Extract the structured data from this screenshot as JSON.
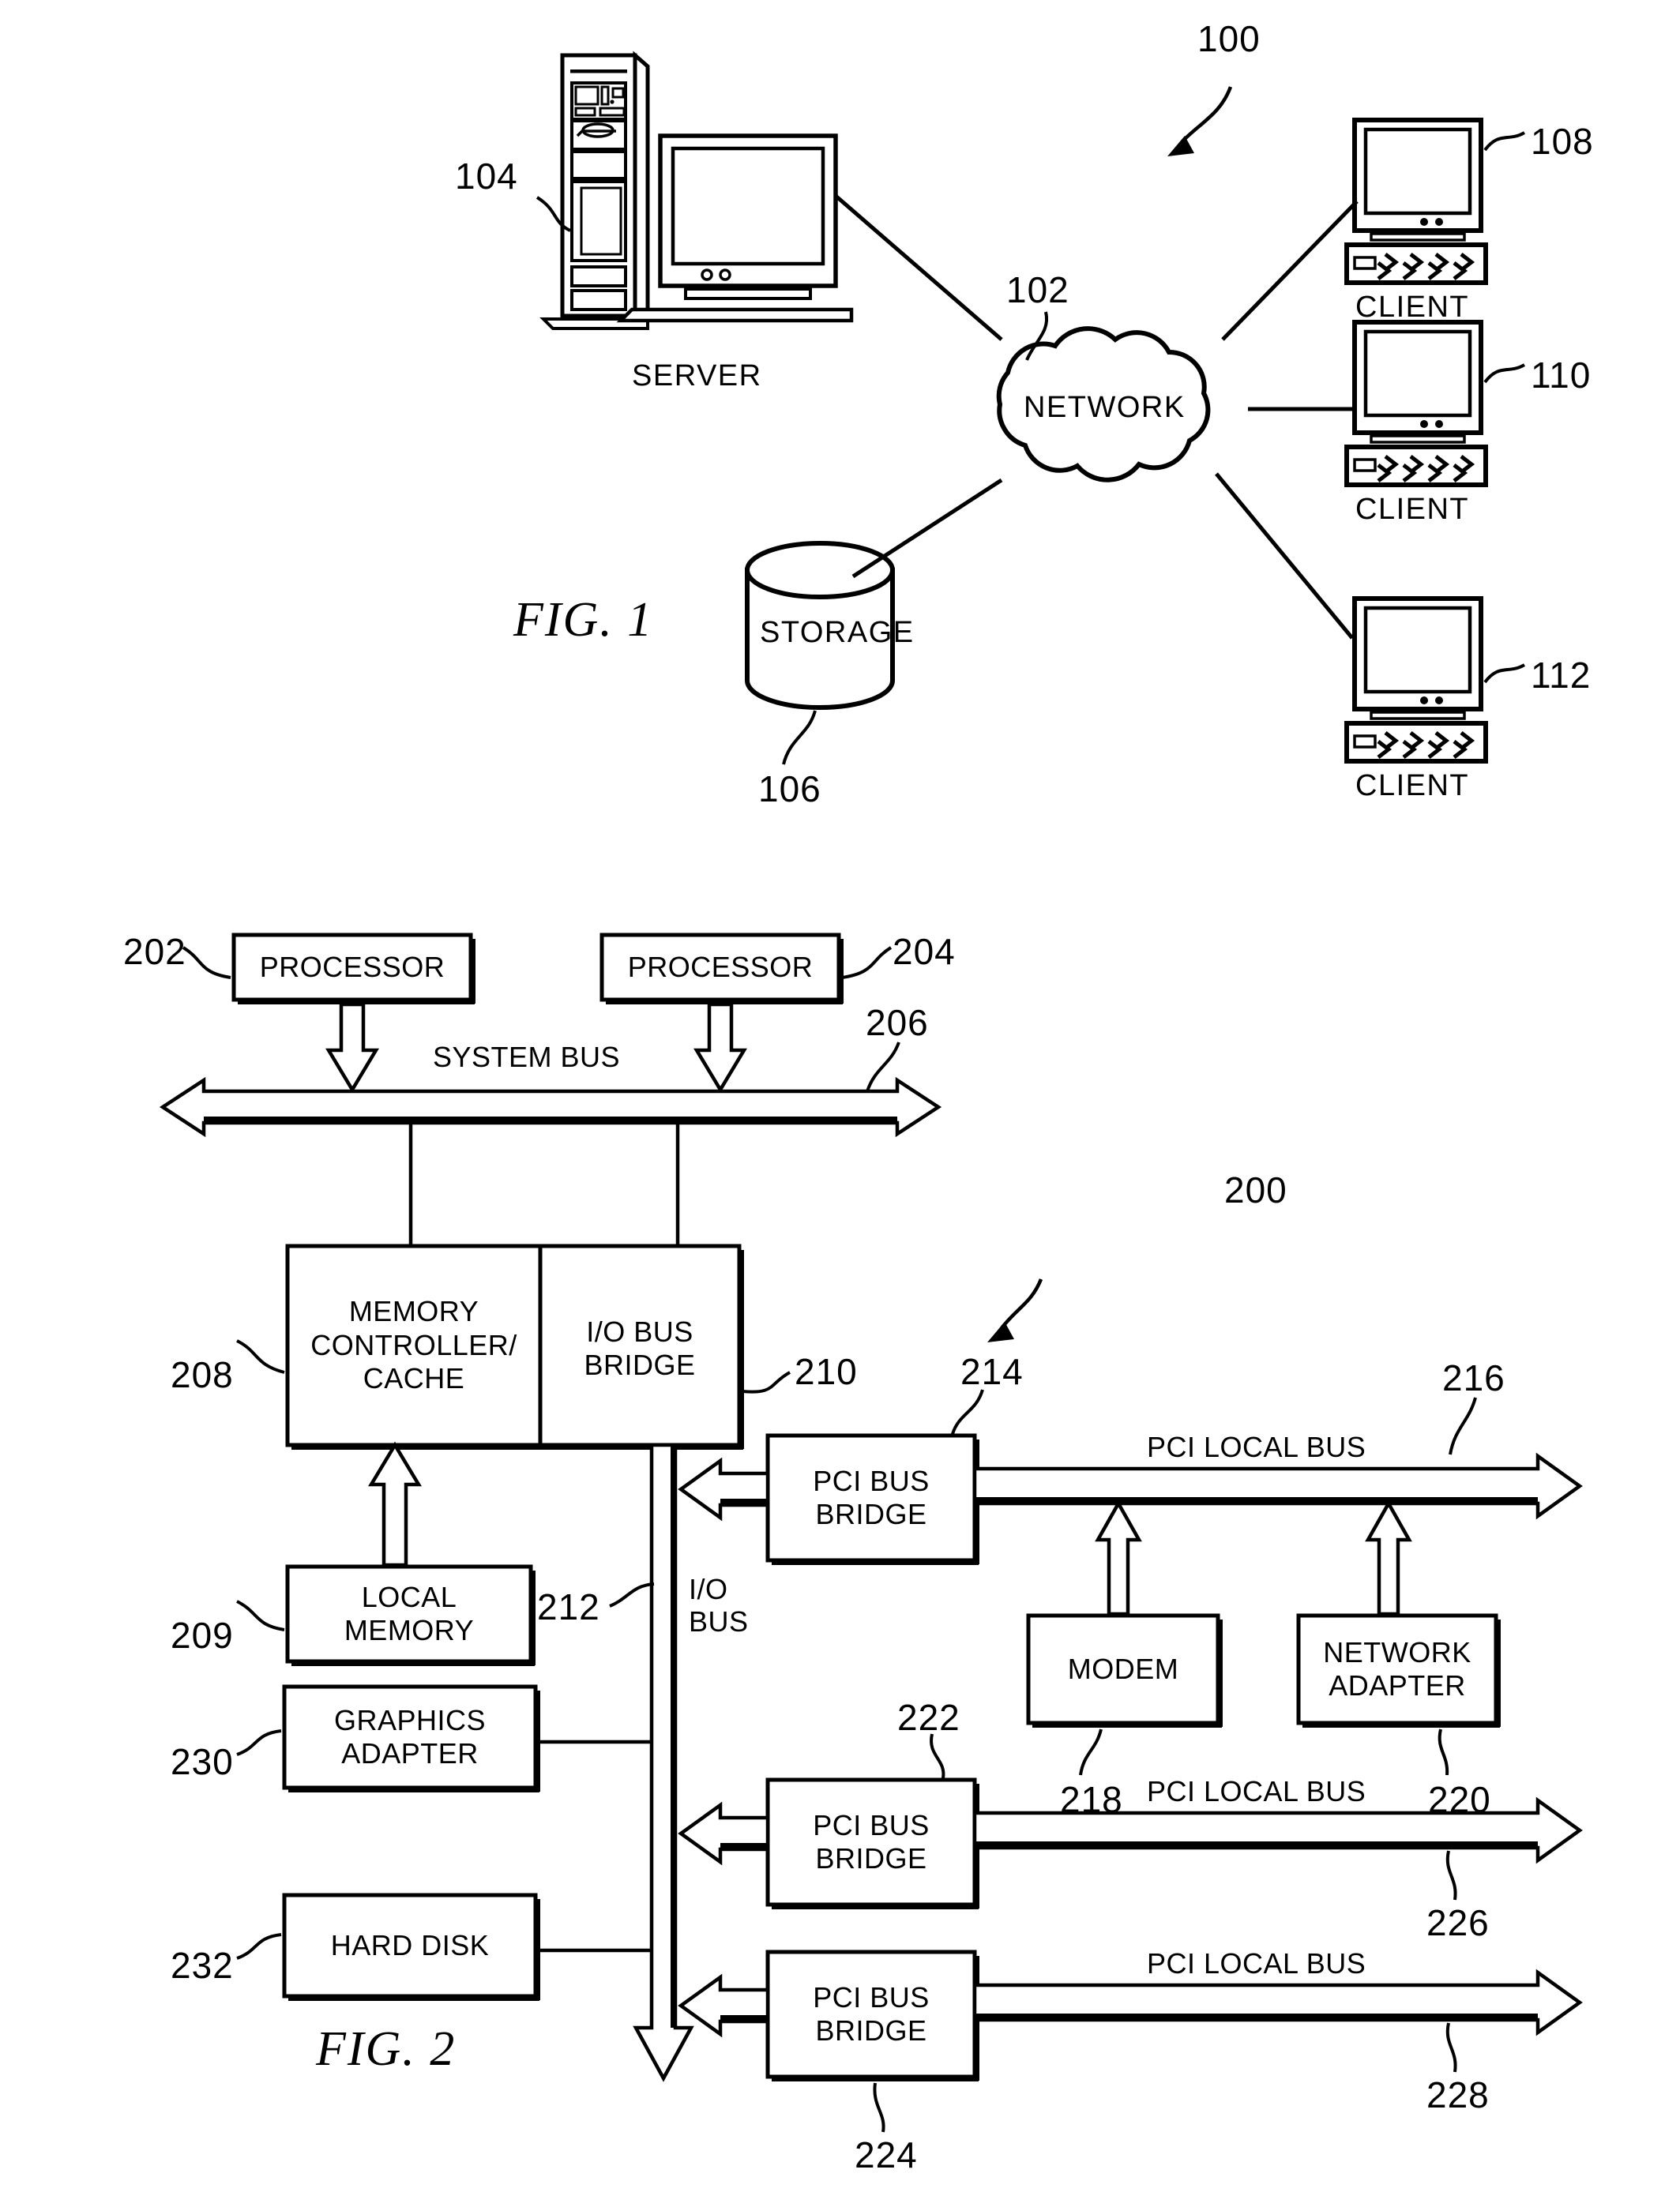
{
  "document": {
    "type": "patent-figure-sheet",
    "figures": [
      "FIG. 1",
      "FIG. 2"
    ]
  },
  "fig1": {
    "label": "FIG. 1",
    "system_ref": "100",
    "nodes": {
      "server": {
        "caption": "SERVER",
        "ref": "104"
      },
      "network": {
        "caption": "NETWORK",
        "ref": "102"
      },
      "storage": {
        "caption": "STORAGE",
        "ref": "106"
      },
      "client1": {
        "caption": "CLIENT",
        "ref": "108"
      },
      "client2": {
        "caption": "CLIENT",
        "ref": "110"
      },
      "client3": {
        "caption": "CLIENT",
        "ref": "112"
      }
    }
  },
  "fig2": {
    "label": "FIG. 2",
    "system_ref": "200",
    "blocks": {
      "processor1": {
        "label": "PROCESSOR",
        "ref": "202"
      },
      "processor2": {
        "label": "PROCESSOR",
        "ref": "204"
      },
      "memory_controller": {
        "line1": "MEMORY",
        "line2": "CONTROLLER/",
        "line3": "CACHE",
        "ref": "208"
      },
      "io_bus_bridge": {
        "line1": "I/O BUS",
        "line2": "BRIDGE",
        "ref": "210"
      },
      "local_memory": {
        "line1": "LOCAL",
        "line2": "MEMORY",
        "ref": "209"
      },
      "pci_bridge_1": {
        "line1": "PCI BUS",
        "line2": "BRIDGE",
        "ref": "214"
      },
      "pci_bridge_2": {
        "line1": "PCI BUS",
        "line2": "BRIDGE",
        "ref": "222"
      },
      "pci_bridge_3": {
        "line1": "PCI BUS",
        "line2": "BRIDGE",
        "ref": "224"
      },
      "modem": {
        "label": "MODEM",
        "ref": "218"
      },
      "network_adapter": {
        "line1": "NETWORK",
        "line2": "ADAPTER",
        "ref": "220"
      },
      "graphics_adapter": {
        "line1": "GRAPHICS",
        "line2": "ADAPTER",
        "ref": "230"
      },
      "hard_disk": {
        "label": "HARD DISK",
        "ref": "232"
      }
    },
    "buses": {
      "system_bus": {
        "label": "SYSTEM BUS",
        "ref": "206"
      },
      "io_bus": {
        "line1": "I/O",
        "line2": "BUS",
        "ref": "212"
      },
      "pci_local_bus_1": {
        "label": "PCI LOCAL BUS",
        "ref": "216"
      },
      "pci_local_bus_2": {
        "label": "PCI LOCAL BUS",
        "ref": "226"
      },
      "pci_local_bus_3": {
        "label": "PCI LOCAL BUS",
        "ref": "228"
      }
    }
  },
  "colors": {
    "ink": "#000000",
    "paper": "#ffffff"
  }
}
